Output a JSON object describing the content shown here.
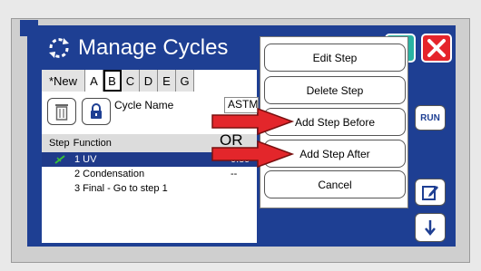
{
  "title": "Manage Cycles",
  "tabs": [
    "*New",
    "A",
    "B",
    "C",
    "D",
    "E",
    "G"
  ],
  "cycle_name": {
    "label": "Cycle Name",
    "value": "ASTM"
  },
  "table": {
    "headers": [
      "Step",
      "Function"
    ],
    "rows": [
      {
        "label": "1 UV",
        "value": "0.89"
      },
      {
        "label": "2 Condensation",
        "value": "--"
      },
      {
        "label": "3 Final - Go to step 1",
        "value": ""
      }
    ]
  },
  "menu": {
    "edit_step": "Edit Step",
    "delete_step": "Delete Step",
    "add_step_before": "Add Step Before",
    "add_step_after": "Add Step After",
    "cancel": "Cancel"
  },
  "side_buttons": {
    "run": "RUN"
  },
  "annotation": {
    "or": "OR"
  },
  "colors": {
    "app_blue": "#1e3f93",
    "selected_row": "#1f3a8a",
    "close_red": "#e5242b",
    "confirm_teal": "#29b3a2",
    "arrow_red": "#e3262b"
  },
  "icons": [
    "refresh-cycle-icon",
    "close-icon",
    "trash-icon",
    "lock-icon",
    "uv-lamp-icon",
    "edit-icon",
    "down-arrow-icon"
  ]
}
